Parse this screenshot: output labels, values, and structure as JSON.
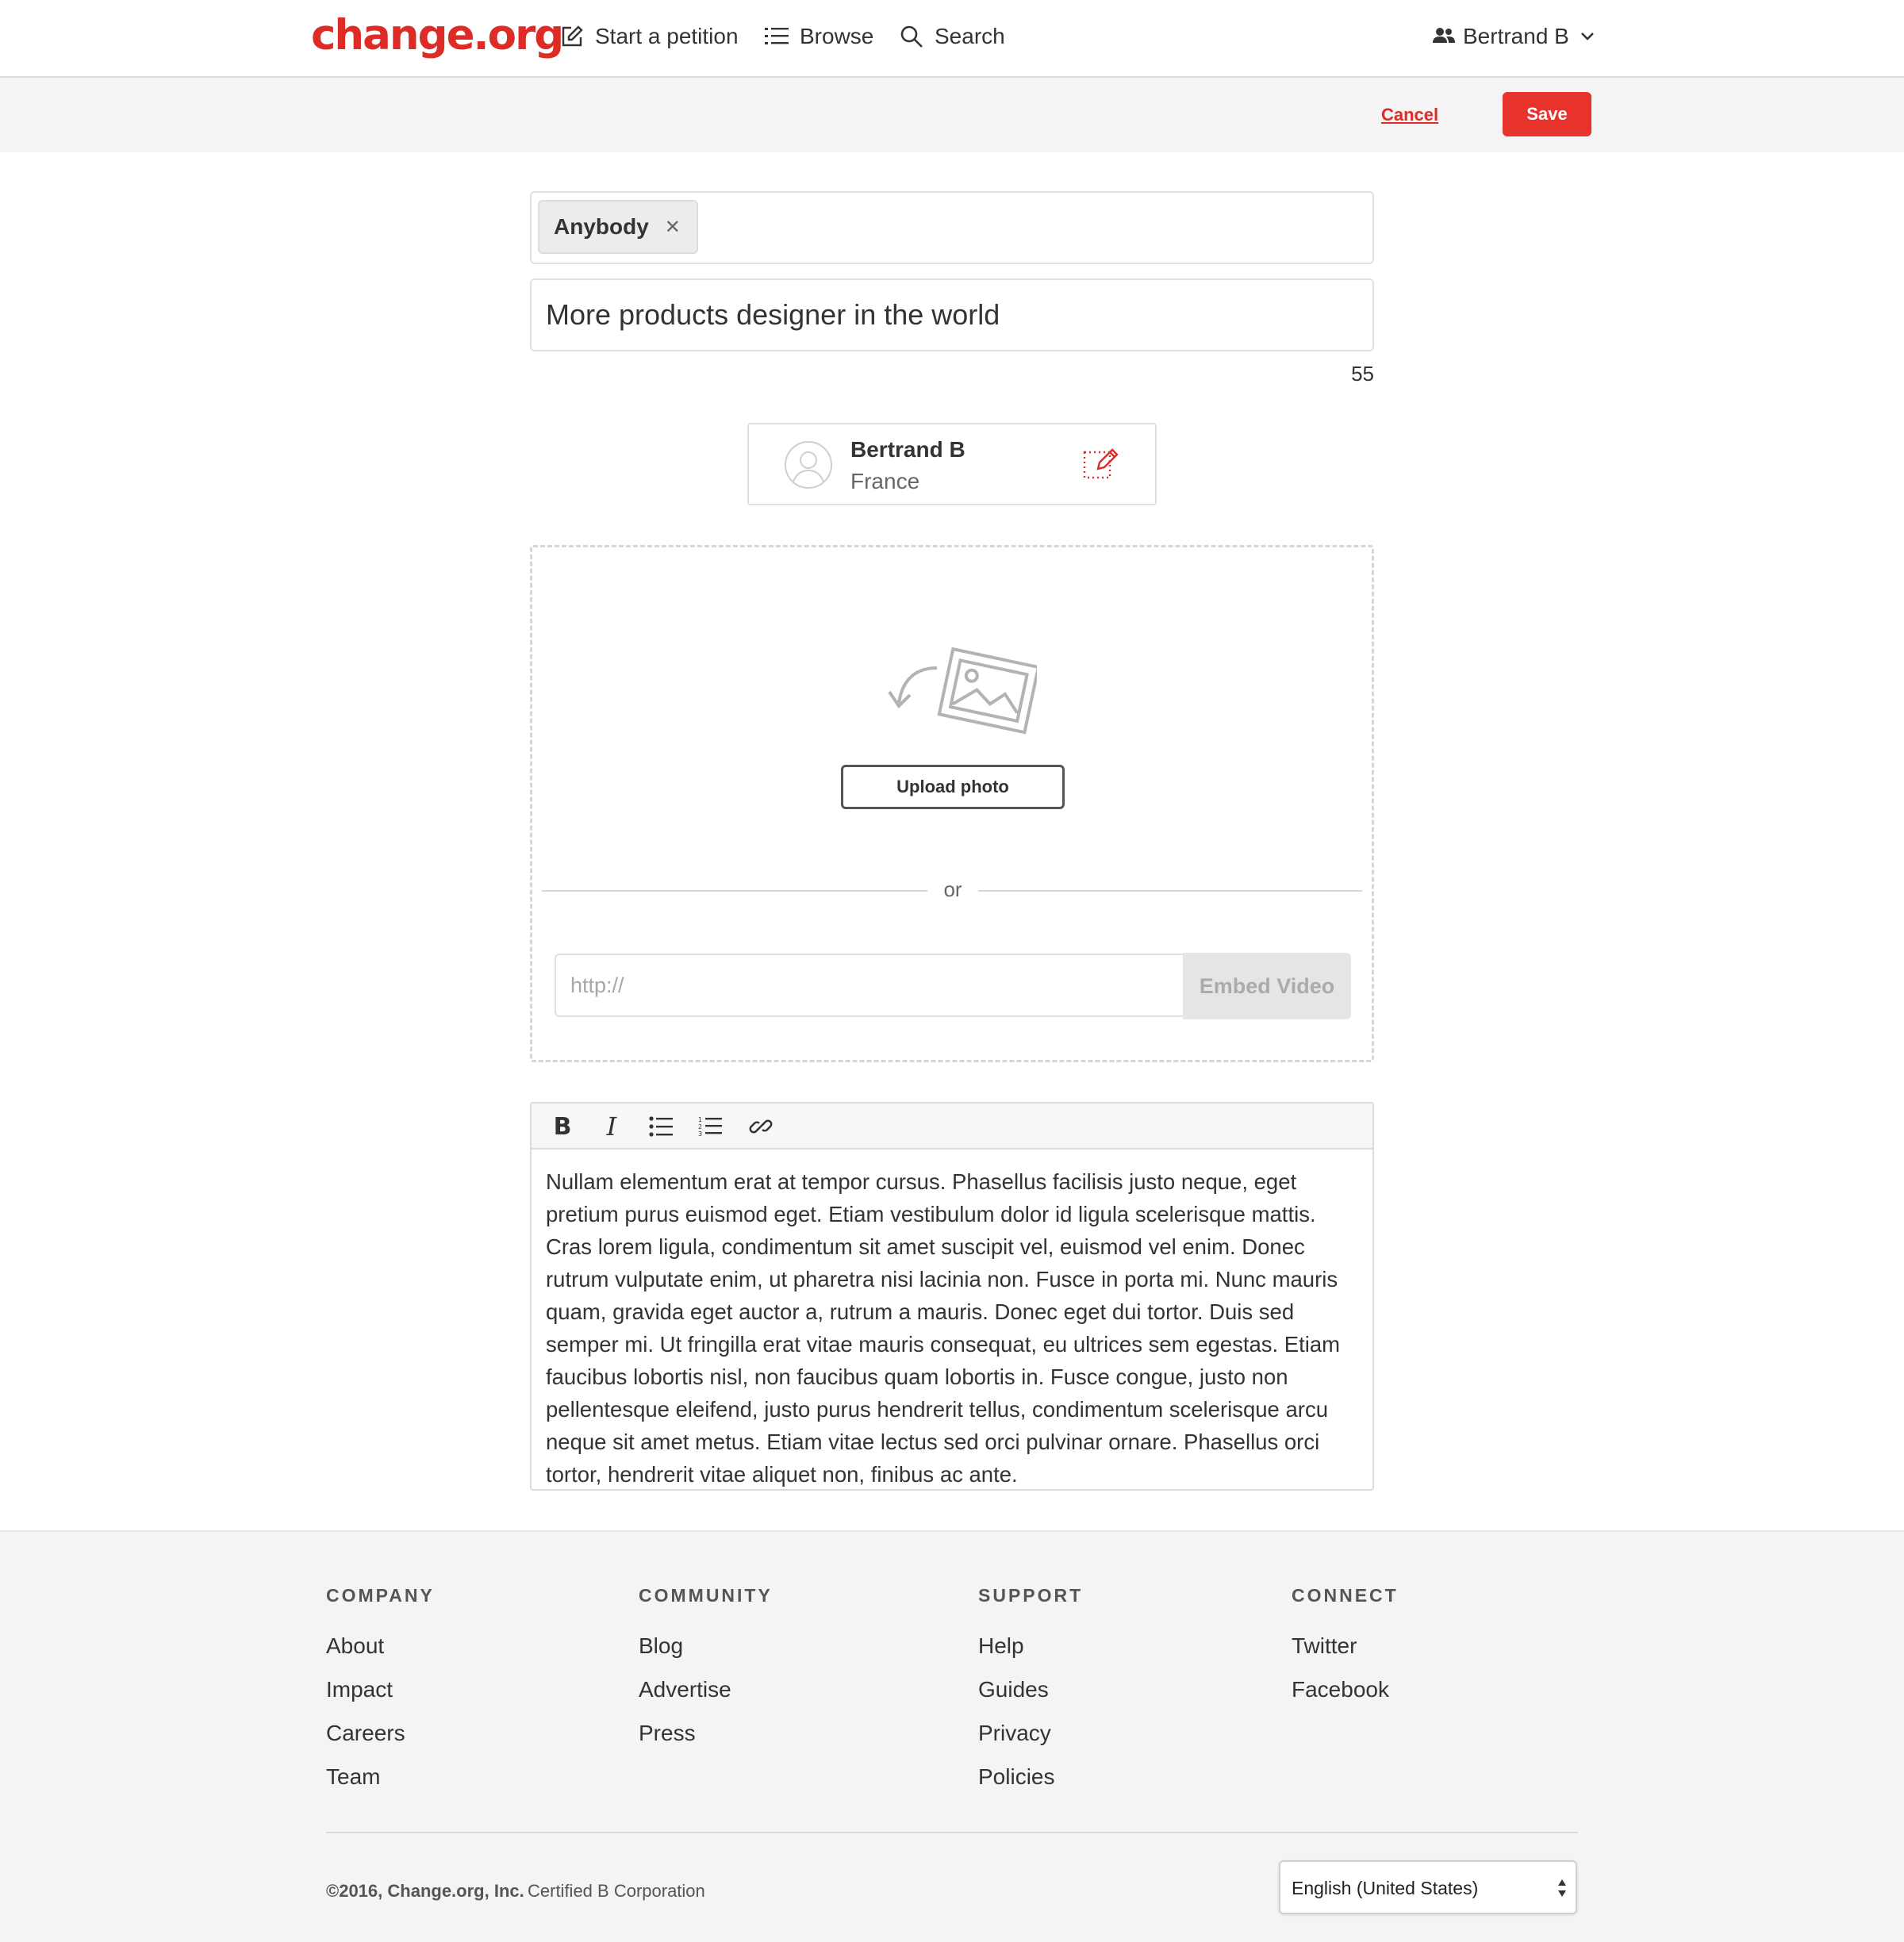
{
  "nav": {
    "logo": "change.org",
    "start_petition": "Start a petition",
    "browse": "Browse",
    "search": "Search",
    "user_name": "Bertrand B"
  },
  "actions": {
    "cancel": "Cancel",
    "save": "Save"
  },
  "form": {
    "target_tag": "Anybody",
    "title_value": "More products designer in the world",
    "char_count": "55",
    "author": {
      "name": "Bertrand B",
      "location": "France"
    },
    "media": {
      "upload_label": "Upload photo",
      "or_label": "or",
      "video_placeholder": "http://",
      "embed_label": "Embed Video"
    },
    "editor": {
      "toolbar": [
        "bold",
        "italic",
        "bulleted-list",
        "numbered-list",
        "link"
      ],
      "body": "Nullam elementum erat at tempor cursus. Phasellus facilisis justo neque, eget pretium purus euismod eget. Etiam vestibulum dolor id ligula scelerisque mattis. Cras lorem ligula, condimentum sit amet suscipit vel, euismod vel enim. Donec rutrum vulputate enim, ut pharetra nisi lacinia non. Fusce in porta mi. Nunc mauris quam, gravida eget auctor a, rutrum a mauris. Donec eget dui tortor. Duis sed semper mi. Ut fringilla erat vitae mauris consequat, eu ultrices sem egestas. Etiam faucibus lobortis nisl, non faucibus quam lobortis in. Fusce congue, justo non pellentesque eleifend, justo purus hendrerit tellus, condimentum scelerisque arcu neque sit amet metus. Etiam vitae lectus sed orci pulvinar ornare. Phasellus orci tortor, hendrerit vitae aliquet non, finibus ac ante."
    }
  },
  "footer": {
    "columns": [
      {
        "heading": "COMPANY",
        "links": [
          "About",
          "Impact",
          "Careers",
          "Team"
        ]
      },
      {
        "heading": "COMMUNITY",
        "links": [
          "Blog",
          "Advertise",
          "Press"
        ]
      },
      {
        "heading": "SUPPORT",
        "links": [
          "Help",
          "Guides",
          "Privacy",
          "Policies"
        ]
      },
      {
        "heading": "CONNECT",
        "links": [
          "Twitter",
          "Facebook"
        ]
      }
    ],
    "copyright": "©2016, Change.org, Inc.",
    "certification": "Certified B Corporation",
    "language": "English (United States)"
  },
  "colors": {
    "brand_red": "#dd2b26",
    "save_red": "#e8322c",
    "bar_gray": "#f4f4f4"
  }
}
